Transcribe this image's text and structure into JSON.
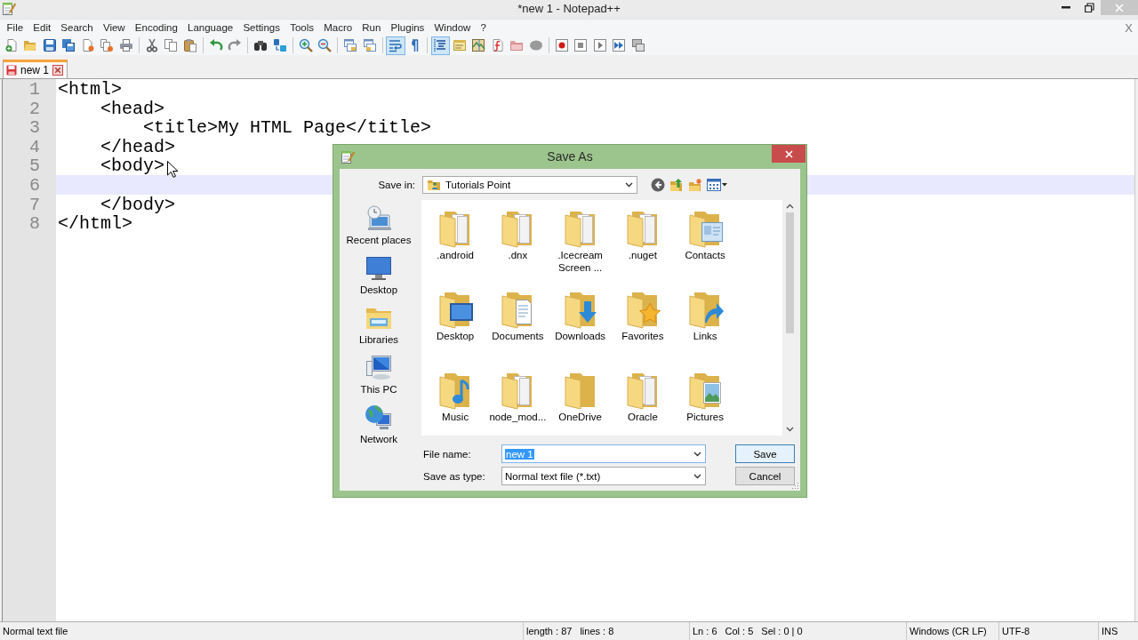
{
  "window": {
    "title": "*new 1 - Notepad++"
  },
  "menu": {
    "items": [
      "File",
      "Edit",
      "Search",
      "View",
      "Encoding",
      "Language",
      "Settings",
      "Tools",
      "Macro",
      "Run",
      "Plugins",
      "Window",
      "?"
    ],
    "close_document": "X"
  },
  "toolbar": [
    [
      {
        "pressed": false
      },
      {
        "pressed": false
      },
      {
        "pressed": false
      },
      {
        "pressed": false
      },
      {
        "pressed": false
      },
      {
        "pressed": false
      },
      {
        "pressed": false
      }
    ],
    [
      {
        "pressed": false
      },
      {
        "pressed": false
      },
      {
        "pressed": false
      }
    ],
    [
      {
        "pressed": false
      },
      {
        "pressed": false
      }
    ],
    [
      {
        "pressed": false
      },
      {
        "pressed": false
      }
    ],
    [
      {
        "pressed": false
      },
      {
        "pressed": false
      }
    ],
    [
      {
        "pressed": false
      },
      {
        "pressed": false
      }
    ],
    [
      {
        "pressed": true
      },
      {
        "pressed": false
      }
    ],
    [
      {
        "pressed": true
      },
      {
        "pressed": false
      },
      {
        "pressed": false
      },
      {
        "pressed": false
      },
      {
        "pressed": false
      },
      {
        "pressed": false
      }
    ],
    [
      {
        "pressed": false
      },
      {
        "pressed": false
      },
      {
        "pressed": false
      },
      {
        "pressed": false
      },
      {
        "pressed": false
      }
    ]
  ],
  "tabs": [
    {
      "label": "new 1",
      "selected": true,
      "modified": true
    }
  ],
  "editor": {
    "lines": [
      {
        "number": "1",
        "text": "<html>",
        "current": false
      },
      {
        "number": "2",
        "text": "    <head>",
        "current": false
      },
      {
        "number": "3",
        "text": "        <title>My HTML Page</title>",
        "current": false
      },
      {
        "number": "4",
        "text": "    </head>",
        "current": false
      },
      {
        "number": "5",
        "text": "    <body>",
        "current": false
      },
      {
        "number": "6",
        "current": true
      },
      {
        "number": "7",
        "text": "    </body>",
        "current": false
      },
      {
        "number": "8",
        "text": "</html>",
        "current": false
      }
    ]
  },
  "save_dialog": {
    "title": "Save As",
    "save_in_label": "Save in:",
    "save_in_value": "Tutorials Point",
    "places": [
      "Recent places",
      "Desktop",
      "Libraries",
      "This PC",
      "Network"
    ],
    "files": [
      ".android",
      ".dnx",
      ".Icecream Screen ...",
      ".nuget",
      "Contacts",
      "Desktop",
      "Documents",
      "Downloads",
      "Favorites",
      "Links",
      "Music",
      "node_mod...",
      "OneDrive",
      "Oracle",
      "Pictures"
    ],
    "file_name": {
      "label": "File name:",
      "value": "new 1",
      "value_selected": true
    },
    "save_as_type": {
      "label": "Save as type:",
      "value": "Normal text file (*.txt)"
    },
    "buttons": [
      {
        "label": "Save",
        "default": true
      },
      {
        "label": "Cancel",
        "default": false
      }
    ]
  },
  "status_bar": {
    "file_type": "Normal text file",
    "length": "length : 87",
    "lines": "lines : 8",
    "line": "Ln : 6",
    "column": "Col : 5",
    "selection": "Sel : 0 | 0",
    "eol": "Windows (CR LF)",
    "encoding": "UTF-8",
    "mode": "INS"
  }
}
